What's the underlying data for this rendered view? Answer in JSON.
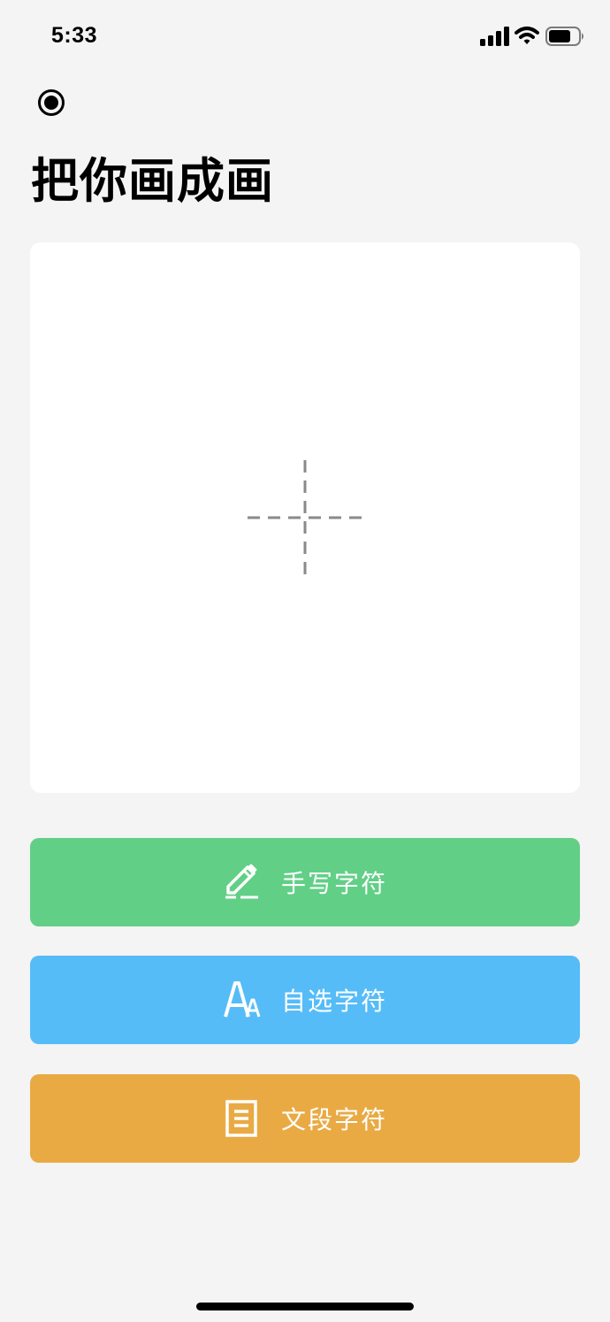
{
  "status_bar": {
    "time": "5:33",
    "icons": [
      "signal-icon",
      "wifi-icon",
      "battery-icon"
    ]
  },
  "header": {
    "icon": "radio-icon",
    "title": "把你画成画"
  },
  "canvas": {
    "icon": "add-icon"
  },
  "actions": [
    {
      "label": "手写字符",
      "icon": "pencil-icon",
      "color": "#62cf87"
    },
    {
      "label": "自选字符",
      "icon": "font-icon",
      "color": "#56bcf8"
    },
    {
      "label": "文段字符",
      "icon": "document-icon",
      "color": "#e9aa44"
    }
  ],
  "colors": {
    "background": "#f4f4f4",
    "card": "#ffffff"
  }
}
